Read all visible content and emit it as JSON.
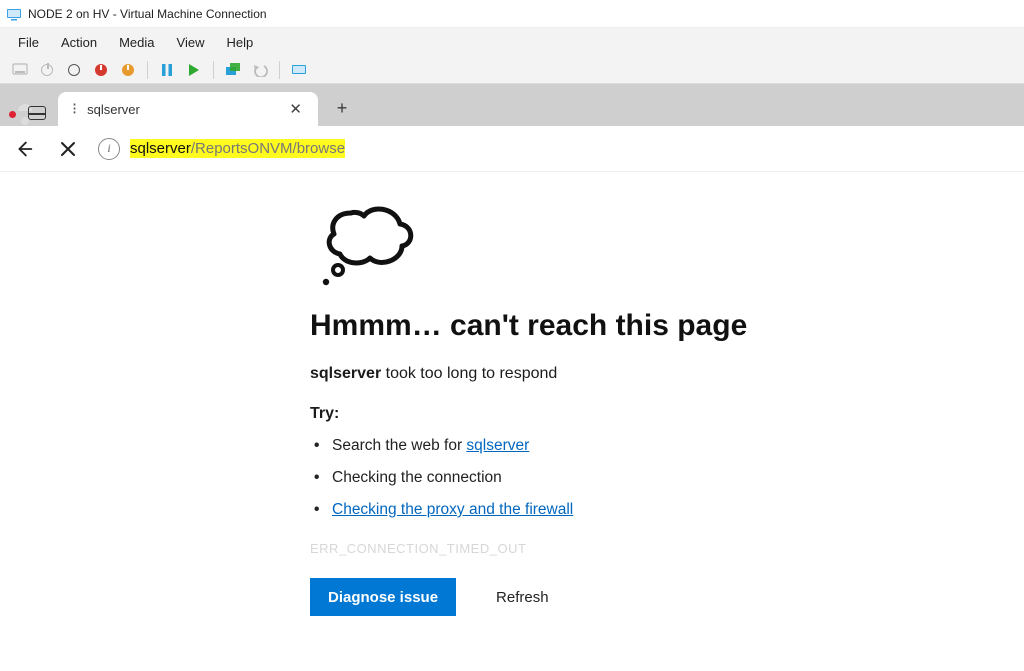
{
  "window": {
    "title": "NODE 2 on HV - Virtual Machine Connection"
  },
  "menubar": {
    "items": [
      "File",
      "Action",
      "Media",
      "View",
      "Help"
    ]
  },
  "browser": {
    "tab": {
      "favicon_glyph": "⁝",
      "title": "sqlserver",
      "close_glyph": "✕"
    },
    "newtab_glyph": "+",
    "nav": {
      "back_tooltip": "Back",
      "stop_tooltip": "Stop",
      "stop_glyph": "✕"
    },
    "address": {
      "info_glyph": "i",
      "host": "sqlserver",
      "path": "/ReportsONVM/browse"
    }
  },
  "error": {
    "heading": "Hmmm… can't reach this page",
    "host": "sqlserver",
    "sub_after": " took too long to respond",
    "try_label": "Try:",
    "items": {
      "search_prefix": "Search the web for ",
      "search_link": "sqlserver",
      "connection": "Checking the connection",
      "proxy_link": "Checking the proxy and the firewall"
    },
    "code": "ERR_CONNECTION_TIMED_OUT",
    "buttons": {
      "diagnose": "Diagnose issue",
      "refresh": "Refresh"
    }
  }
}
